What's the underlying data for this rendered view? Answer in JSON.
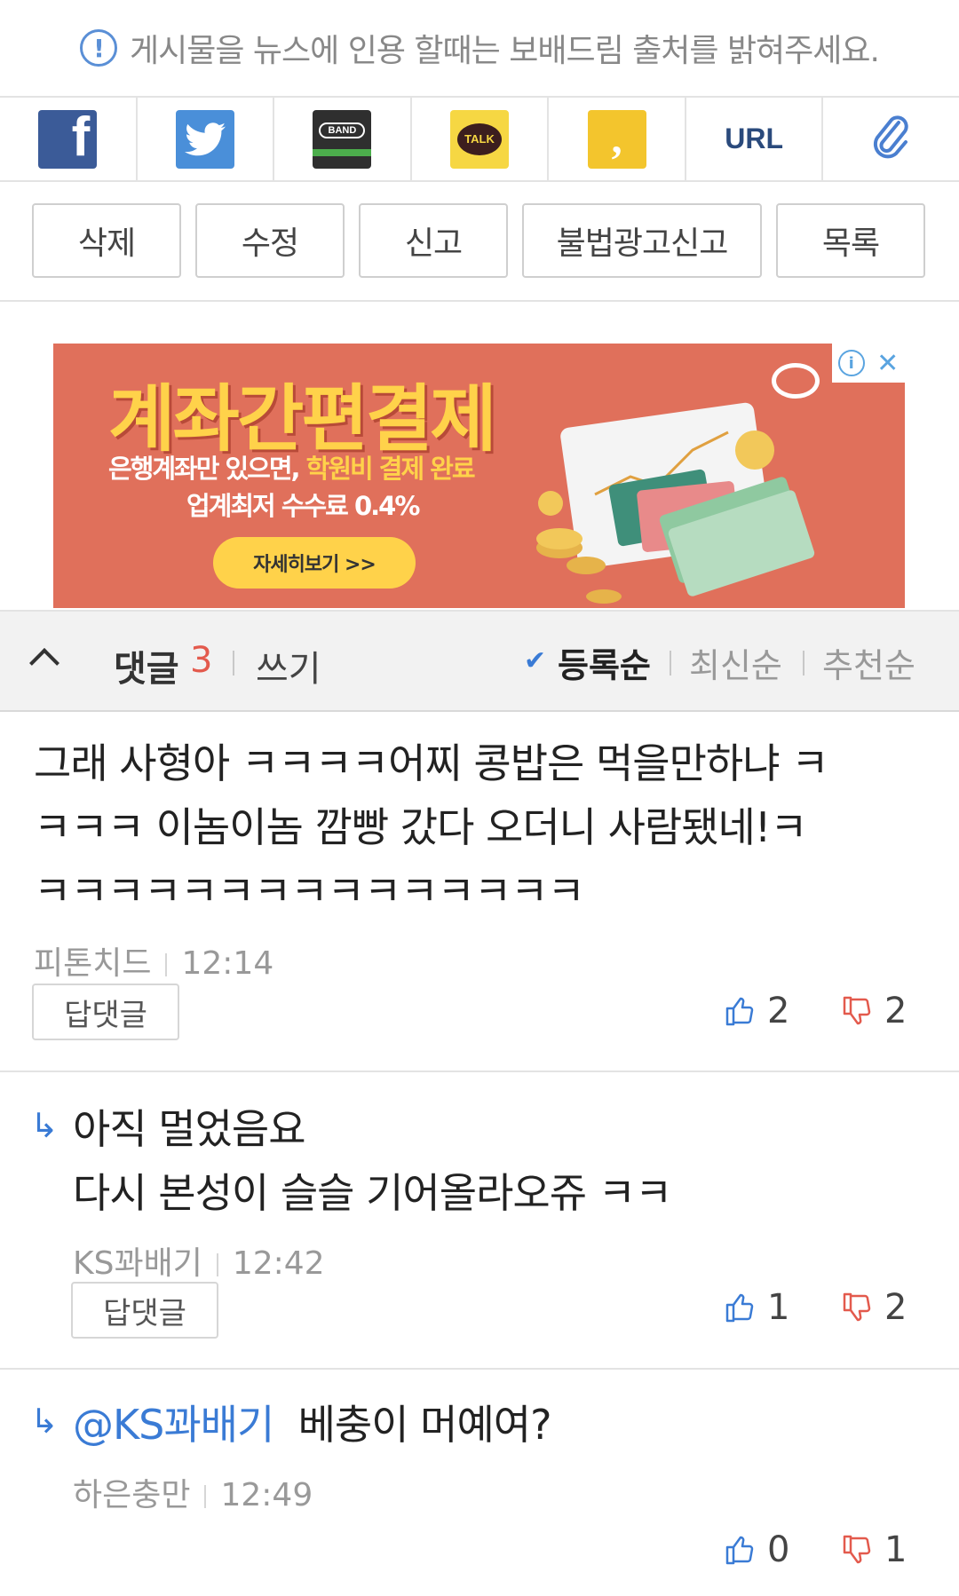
{
  "notice": {
    "text": "게시물을 뉴스에 인용 할때는 보배드림 출처를 밝혀주세요."
  },
  "share": {
    "icons": [
      "facebook-icon",
      "twitter-icon",
      "band-icon",
      "kakaotalk-icon",
      "kakaostory-icon",
      "url-icon",
      "clip-icon"
    ],
    "band_label": "BAND",
    "talk_label": "TALK",
    "url_label": "URL"
  },
  "actions": {
    "delete": "삭제",
    "edit": "수정",
    "report": "신고",
    "report_ad": "불법광고신고",
    "list": "목록"
  },
  "ad": {
    "title": "계좌간편결제",
    "line1_a": "은행계좌만 있으면, ",
    "line1_b": "학원비 결제 완료",
    "line2": "업계최저 수수료 0.4%",
    "cta": "자세히보기 >>"
  },
  "comments_bar": {
    "title": "댓글",
    "count": "3",
    "write": "쓰기",
    "sort_registered": "등록순",
    "sort_latest": "최신순",
    "sort_recommended": "추천순"
  },
  "comments": [
    {
      "lines": [
        "그래 사형아 ㅋㅋㅋㅋ어찌 콩밥은 먹을만하냐 ㅋ",
        "ㅋㅋㅋ 이놈이놈 깜빵 갔다 오더니 사람됐네!ㅋ",
        "ㅋㅋㅋㅋㅋㅋㅋㅋㅋㅋㅋㅋㅋㅋㅋ"
      ],
      "author": "피톤치드",
      "time": "12:14",
      "reply_label": "답댓글",
      "up": "2",
      "down": "2"
    },
    {
      "lines": [
        "아직 멀었음요",
        "다시 본성이 슬슬 기어올라오쥬 ㅋㅋ"
      ],
      "author": "KS꽈배기",
      "time": "12:42",
      "reply_label": "답댓글",
      "up": "1",
      "down": "2"
    },
    {
      "mention": "@KS꽈배기",
      "text": "베충이 머예여?",
      "author": "하은충만",
      "time": "12:49",
      "up": "0",
      "down": "1"
    }
  ]
}
